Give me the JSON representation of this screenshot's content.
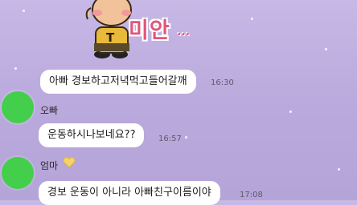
{
  "sticker": {
    "text": "미안",
    "dots": "...",
    "shirt_letter": "T"
  },
  "messages": [
    {
      "sender": "",
      "text": "아빠 경보하고저녁먹고들어갈깨",
      "time": "16:30"
    },
    {
      "sender": "오빠",
      "text": "운동하시나보네요??",
      "time": "16:57"
    },
    {
      "sender": "엄마",
      "sender_icon": "yellow-heart-icon",
      "text": "경보 운동이 아니라 아빠친구이름이야",
      "time": "17:08"
    }
  ],
  "colors": {
    "avatar": "#43cf4b",
    "background": "#c7b8e6",
    "bubble": "#ffffff",
    "sticker_text": "#e0567a"
  }
}
